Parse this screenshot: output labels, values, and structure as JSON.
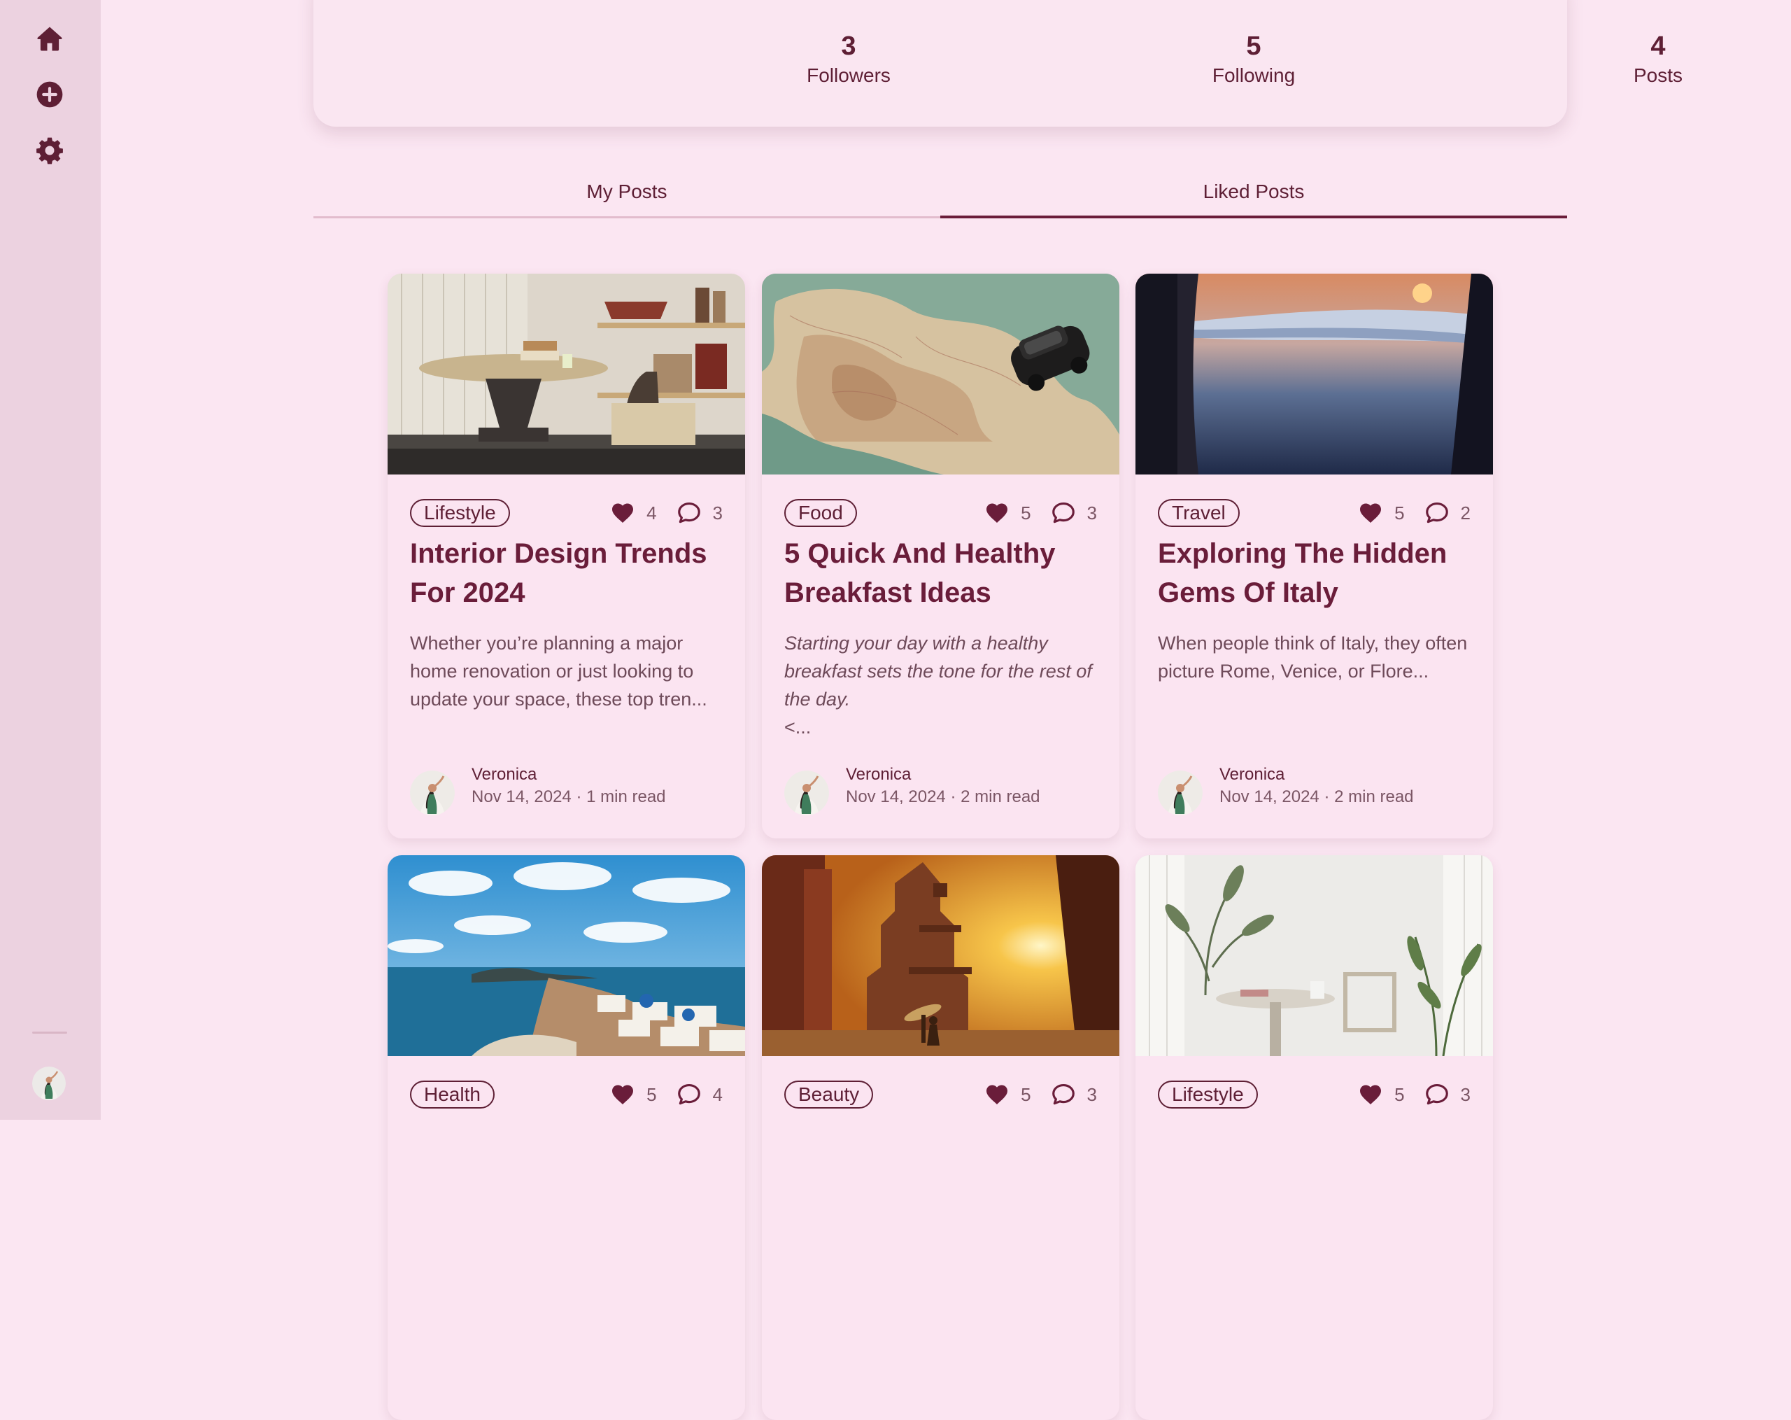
{
  "sidebar": {
    "items": [
      {
        "name": "home",
        "icon": "home-icon"
      },
      {
        "name": "create",
        "icon": "plus-circle-icon"
      },
      {
        "name": "settings",
        "icon": "gear-icon"
      }
    ],
    "avatar_icon": "user-avatar"
  },
  "stats": [
    {
      "value": "3",
      "label": "Followers"
    },
    {
      "value": "5",
      "label": "Following"
    },
    {
      "value": "4",
      "label": "Posts"
    }
  ],
  "tabs": [
    {
      "label": "My Posts",
      "active": false
    },
    {
      "label": "Liked Posts",
      "active": true
    }
  ],
  "posts": [
    {
      "tag": "Lifestyle",
      "likes": "4",
      "comments": "3",
      "title": "Interior Design Trends For 2024",
      "excerpt": "Whether you’re planning a major home renovation or just looking to update your space, these top tren...",
      "excerpt_tail": "",
      "author": "Veronica",
      "date": "Nov 14, 2024",
      "sep": "·",
      "read": "1 min read"
    },
    {
      "tag": "Food",
      "likes": "5",
      "comments": "3",
      "title": "5 Quick And Healthy Breakfast Ideas",
      "excerpt": "Starting your day with a healthy breakfast sets the tone for the rest of the day.",
      "excerpt_tail": "<...",
      "author": "Veronica",
      "date": "Nov 14, 2024",
      "sep": "·",
      "read": "2 min read"
    },
    {
      "tag": "Travel",
      "likes": "5",
      "comments": "2",
      "title": "Exploring The Hidden Gems Of Italy",
      "excerpt": "When people think of Italy, they often picture Rome, Venice, or Flore...",
      "excerpt_tail": "",
      "author": "Veronica",
      "date": "Nov 14, 2024",
      "sep": "·",
      "read": "2 min read"
    },
    {
      "tag": "Health",
      "likes": "5",
      "comments": "4"
    },
    {
      "tag": "Beauty",
      "likes": "5",
      "comments": "3"
    },
    {
      "tag": "Lifestyle",
      "likes": "5",
      "comments": "3"
    }
  ],
  "colors": {
    "background": "#fbe6f2",
    "sidebar": "#ecd2e0",
    "primary": "#5e1f35",
    "title": "#6a1d3a",
    "muted": "#7b5665"
  }
}
